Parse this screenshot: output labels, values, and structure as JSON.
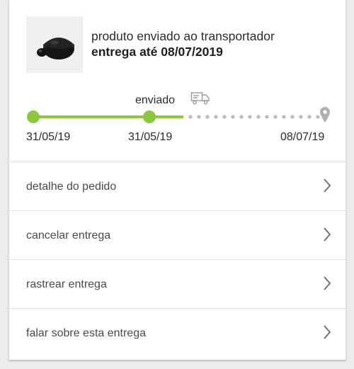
{
  "order": {
    "status_text": "produto enviado ao transportador",
    "delivery_text": "entrega até 08/07/2019",
    "product_image_icon": "earbuds-image"
  },
  "tracker": {
    "current_label": "enviado",
    "dates": [
      "31/05/19",
      "31/05/19",
      "08/07/19"
    ],
    "progress_fraction": 0.5,
    "accent_color": "#8dc63f",
    "pending_color": "#bdbdbd",
    "icons": [
      "truck-icon",
      "location-pin-icon"
    ]
  },
  "menu": {
    "items": [
      {
        "label": "detalhe do pedido"
      },
      {
        "label": "cancelar entrega"
      },
      {
        "label": "rastrear entrega"
      },
      {
        "label": "falar sobre esta entrega"
      }
    ]
  }
}
